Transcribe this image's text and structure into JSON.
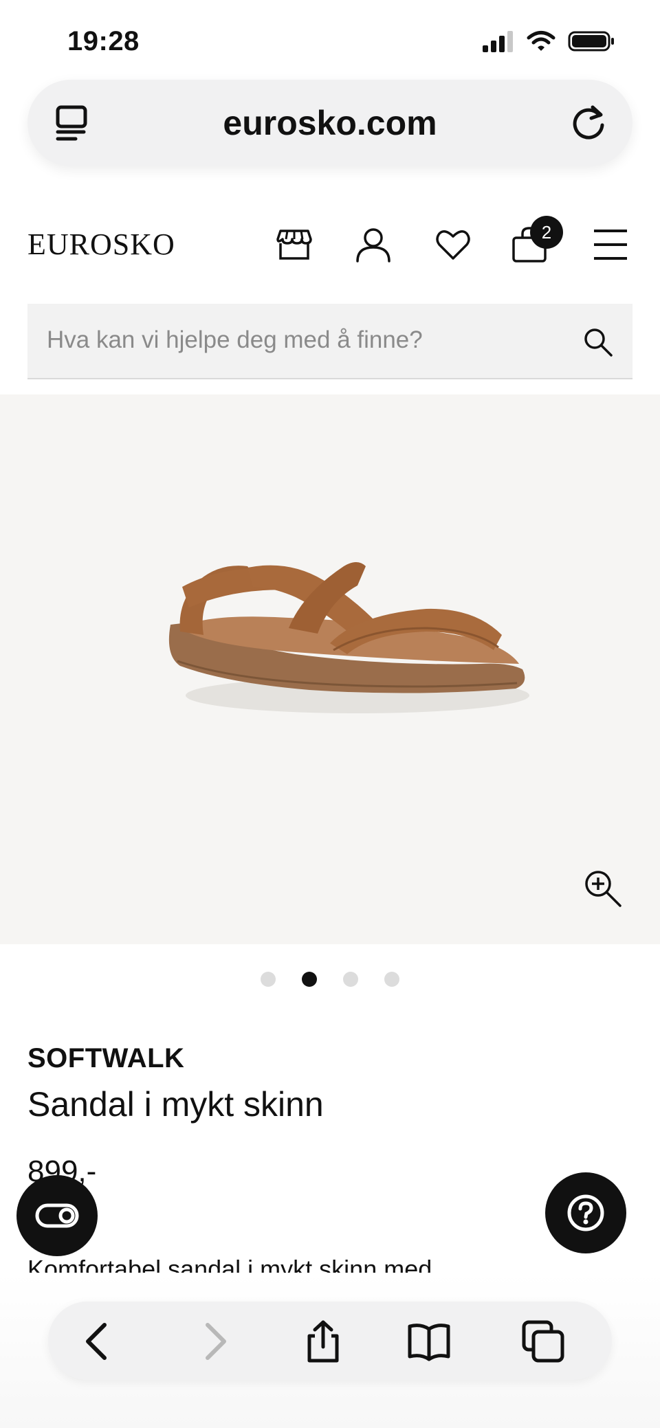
{
  "status_bar": {
    "time": "19:28"
  },
  "browser": {
    "url": "eurosko.com"
  },
  "site": {
    "logo": "EUROSKO",
    "cart_count": "2",
    "search_placeholder": "Hva kan vi hjelpe deg med å finne?"
  },
  "gallery": {
    "image_count": 4,
    "active_index": 1
  },
  "product": {
    "brand": "SOFTWALK",
    "name": "Sandal i mykt skinn",
    "price": "899,-",
    "description": "Komfortabel sandal i mykt skinn med"
  },
  "colors": {
    "accent": "#111111",
    "product": "#a86a3c",
    "image_bg": "#f6f5f3"
  }
}
